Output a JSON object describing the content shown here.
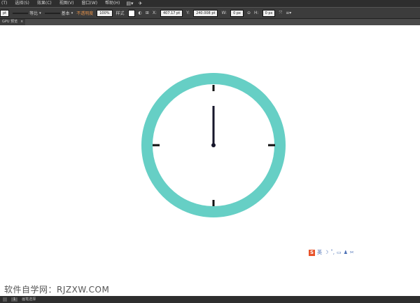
{
  "menubar": {
    "items": [
      "(T)",
      "选择(S)",
      "效果(C)",
      "视图(V)",
      "窗口(W)",
      "帮助(H)"
    ],
    "icons": [
      "align-icon",
      "send-icon"
    ]
  },
  "optbar": {
    "profile_value": "pt",
    "stroke_label": "等比",
    "brush_label": "基本",
    "opacity_label": "不透明度",
    "opacity_value": "100%",
    "style_label": "样式",
    "x_value": "407.17 pt",
    "y_value": "240.008 pt",
    "w_value": "0 px",
    "h_value": "0 px"
  },
  "tab": {
    "label": "GPU 预览",
    "close": "×"
  },
  "clock": {
    "ring_color": "#66cfc5",
    "tick_color": "#111111",
    "hand_color": "#16162a"
  },
  "tray": {
    "logo": "S",
    "items": [
      "英",
      "☽",
      "˚,",
      "▭",
      "♟",
      "✂"
    ]
  },
  "watermark": "软件自学网：RJZXW.COM",
  "statusbar": {
    "zoom": "",
    "artboard": "1",
    "mode": "画笔选择"
  }
}
